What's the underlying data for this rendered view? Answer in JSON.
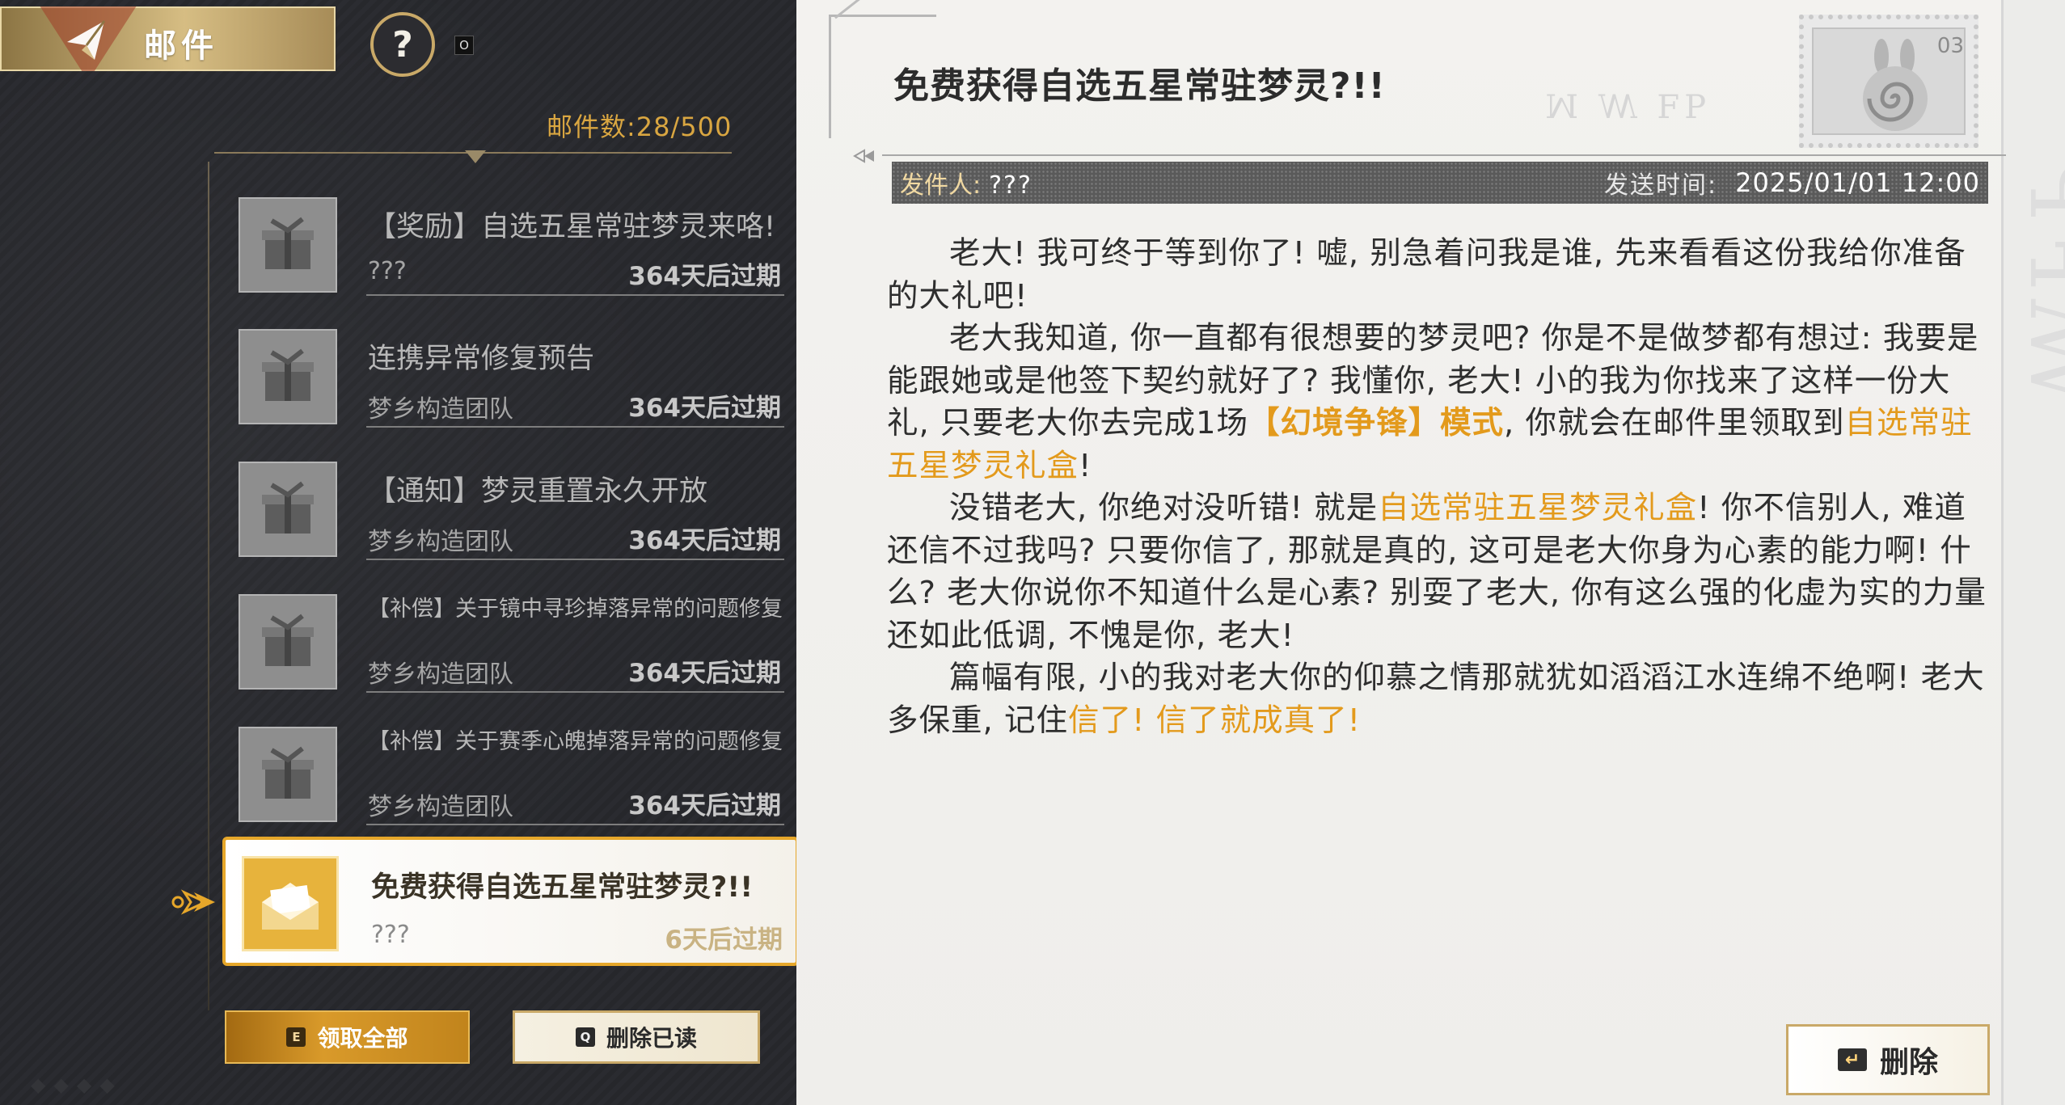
{
  "header": {
    "title": "邮件",
    "help_symbol": "?",
    "help_key": "O"
  },
  "mailbox": {
    "count_label": "邮件数:28/500"
  },
  "mails": [
    {
      "title": "【奖励】自选五星常驻梦灵来咯!",
      "sender": "???",
      "expiry": "364天后过期"
    },
    {
      "title": "连携异常修复预告",
      "sender": "梦乡构造团队",
      "expiry": "364天后过期"
    },
    {
      "title": "【通知】梦灵重置永久开放",
      "sender": "梦乡构造团队",
      "expiry": "364天后过期"
    },
    {
      "title": "【补偿】关于镜中寻珍掉落异常的问题修复",
      "sender": "梦乡构造团队",
      "expiry": "364天后过期"
    },
    {
      "title": "【补偿】关于赛季心魄掉落异常的问题修复",
      "sender": "梦乡构造团队",
      "expiry": "364天后过期"
    }
  ],
  "selected_mail": {
    "title": "免费获得自选五星常驻梦灵?!!",
    "sender": "???",
    "expiry": "6天后过期"
  },
  "buttons": {
    "collect_all_key": "E",
    "collect_all": "领取全部",
    "delete_read_key": "Q",
    "delete_read": "删除已读",
    "delete": "删除"
  },
  "detail": {
    "title": "免费获得自选五星常驻梦灵?!!",
    "sender_label": "发件人:",
    "sender": "???",
    "time_label": "发送时间:",
    "time": "2025/01/01 12:00",
    "stamp_number": "03",
    "p1": "老大! 我可终于等到你了! 嘘, 别急着问我是谁, 先来看看这份我给你准备的大礼吧!",
    "p2_a": "老大我知道, 你一直都有很想要的梦灵吧? 你是不是做梦都有想过: 我要是能跟她或是他签下契约就好了? 我懂你, 老大! 小的我为你找来了这样一份大礼, 只要老大你去完成1场",
    "p2_hl1": "【幻境争锋】模式",
    "p2_b": ", 你就会在邮件里领取到",
    "p2_hl2": "自选常驻五星梦灵礼盒",
    "p2_c": "!",
    "p3_a": "没错老大, 你绝对没听错! 就是",
    "p3_hl": "自选常驻五星梦灵礼盒",
    "p3_b": "! 你不信别人, 难道还信不过我吗? 只要你信了, 那就是真的, 这可是老大你身为心素的能力啊! 什么? 老大你说你不知道什么是心素? 别耍了老大, 你有这么强的化虚为实的力量还如此低调, 不愧是你, 老大!",
    "p4_a": "篇幅有限, 小的我对老大你的仰慕之情那就犹如滔滔江水连绵不绝啊! 老大多保重, 记住",
    "p4_hl": "信了! 信了就成真了!"
  }
}
